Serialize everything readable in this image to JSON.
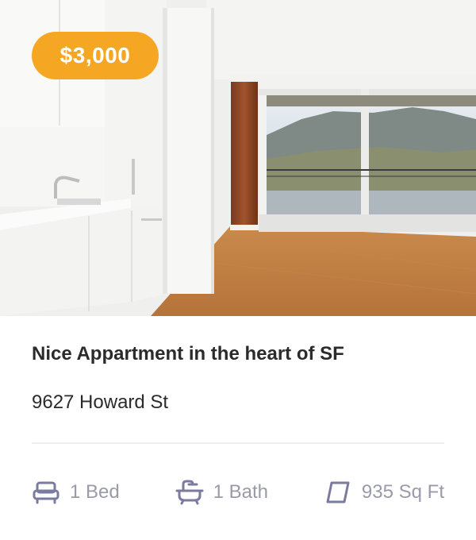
{
  "listing": {
    "price": "$3,000",
    "title": "Nice Appartment in the heart of SF",
    "address": "9627 Howard St"
  },
  "amenities": {
    "bed": {
      "label": "1 Bed",
      "icon": "bed-icon"
    },
    "bath": {
      "label": "1 Bath",
      "icon": "bathtub-icon"
    },
    "area": {
      "label": "935 Sq Ft",
      "icon": "area-icon"
    }
  },
  "colors": {
    "accent": "#f5a623",
    "text": "#2b2b2b",
    "muted": "#9a9aa8",
    "icon": "#7b7ba0"
  }
}
